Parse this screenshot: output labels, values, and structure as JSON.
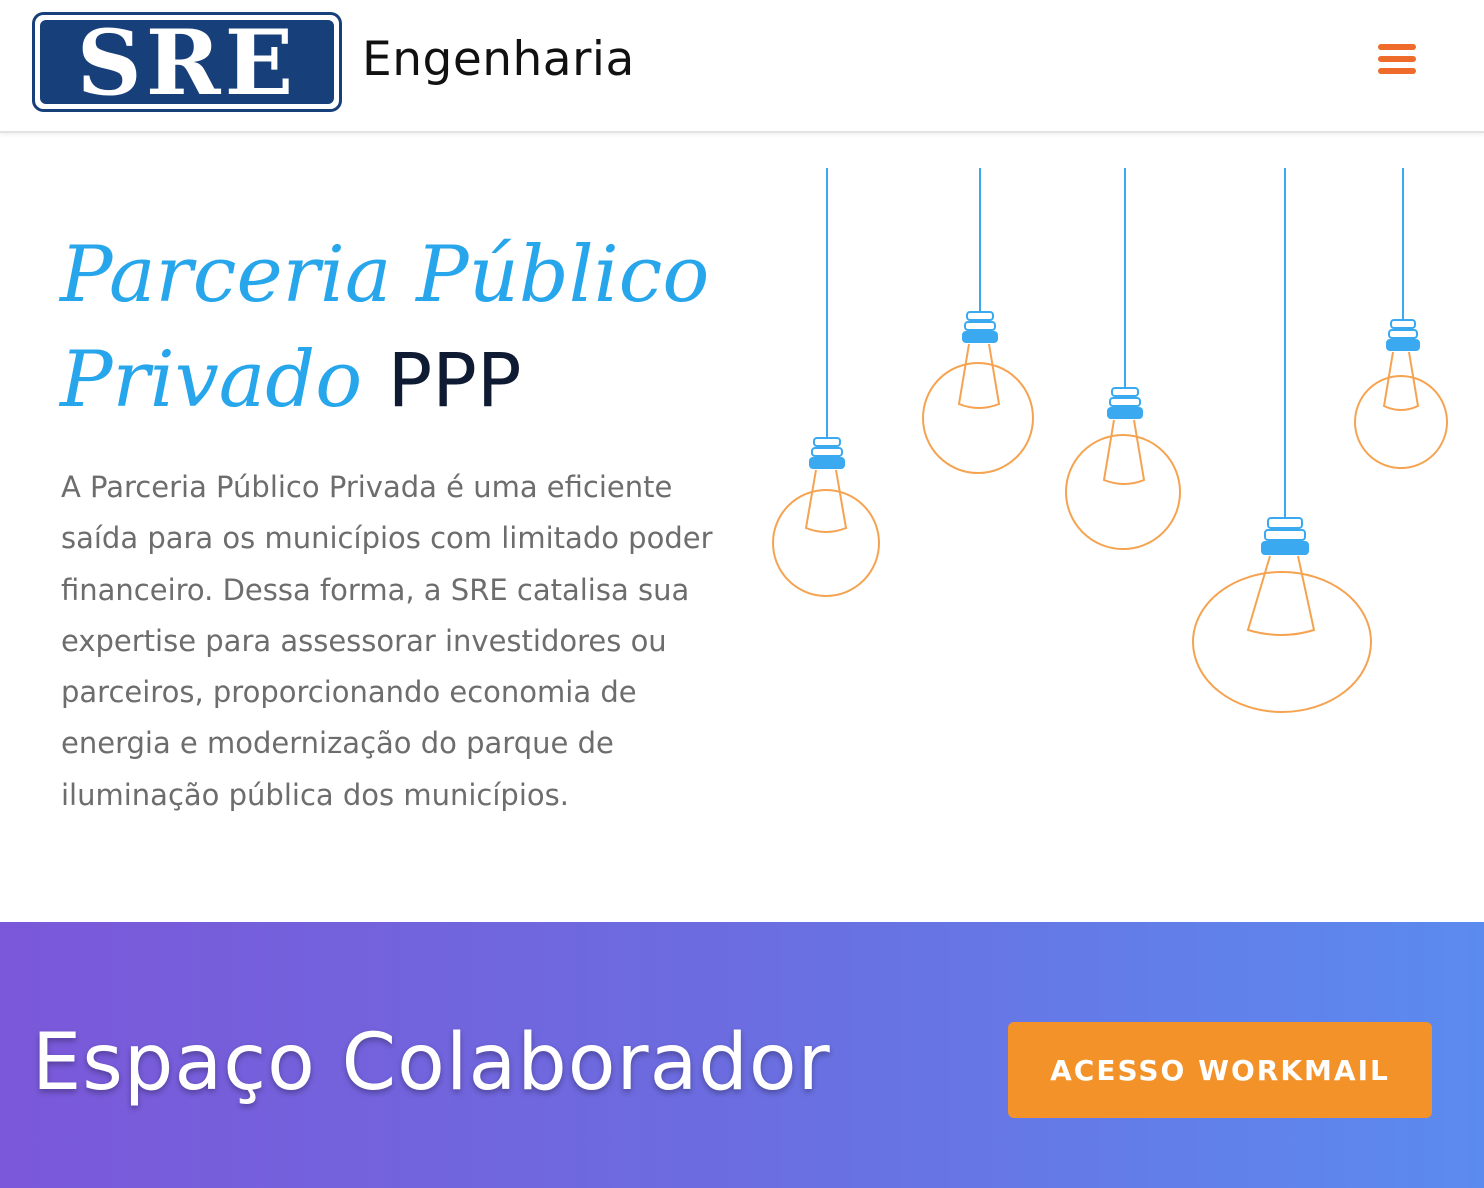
{
  "header": {
    "logo_text": "SRE",
    "brand_name": "Engenharia",
    "menu_icon": "hamburger-menu-icon"
  },
  "hero": {
    "title_italic": "Parceria Público Privado",
    "title_plain": "PPP",
    "paragraph": "A Parceria Público Privada é uma eficiente saída para os municípios com limitado poder financeiro. Dessa forma, a SRE catalisa sua expertise para assessorar investidores ou parceiros, proporcionando economia de energia e modernização do parque de iluminação pública dos municípios.",
    "illustration_icon": "hanging-light-bulbs-icon"
  },
  "banner": {
    "title": "Espaço Colaborador",
    "button_label": "ACESSO WORKMAIL"
  },
  "colors": {
    "accent_blue": "#27a6eb",
    "menu_orange": "#ef6b2c",
    "button_orange": "#f39229",
    "logo_blue": "#173f7a",
    "bulb_orange": "#f5a350",
    "bulb_socket_blue": "#3aa9ef",
    "banner_gradient_start": "#7b58d9",
    "banner_gradient_end": "#5b8bef"
  }
}
